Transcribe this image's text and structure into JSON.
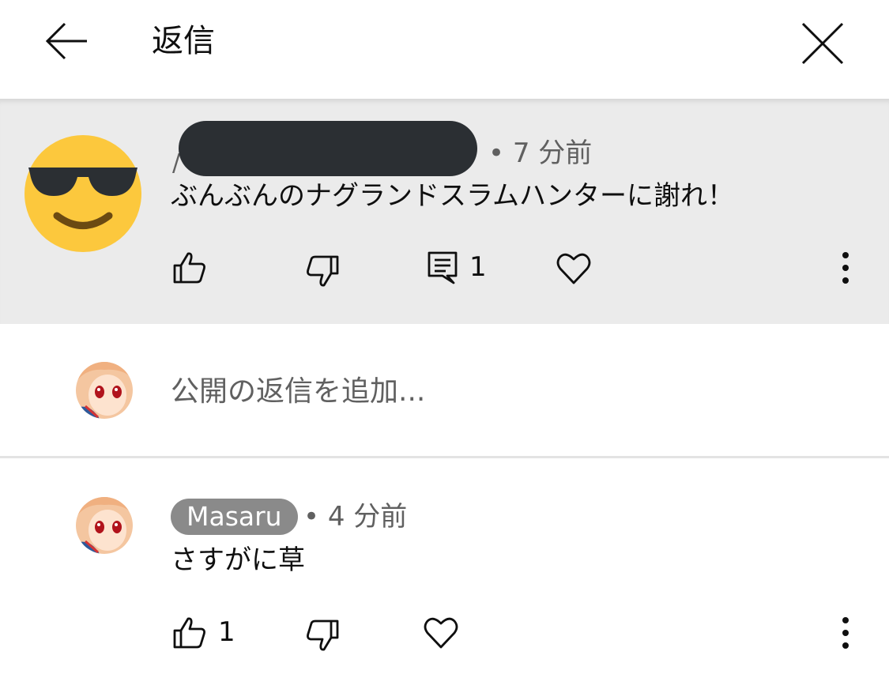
{
  "header": {
    "title": "返信",
    "back_icon": "arrow-left-icon",
    "close_icon": "close-icon"
  },
  "parent_comment": {
    "avatar_icon": "sunglasses-emoji",
    "author_initial": "/",
    "time": "• 7 分前",
    "text": "ぶんぶんのナグランドスラムハンターに謝れ！",
    "reply_count": "1"
  },
  "reply_box": {
    "placeholder": "公開の返信を追加..."
  },
  "reply": {
    "author": "Masaru",
    "time": "• 4 分前",
    "text": "さすがに草",
    "like_count": "1"
  },
  "colors": {
    "parent_bg": "#ebebeb",
    "chip_bg": "#8a8a8a",
    "text": "#0f0f0f",
    "muted": "#606060"
  }
}
